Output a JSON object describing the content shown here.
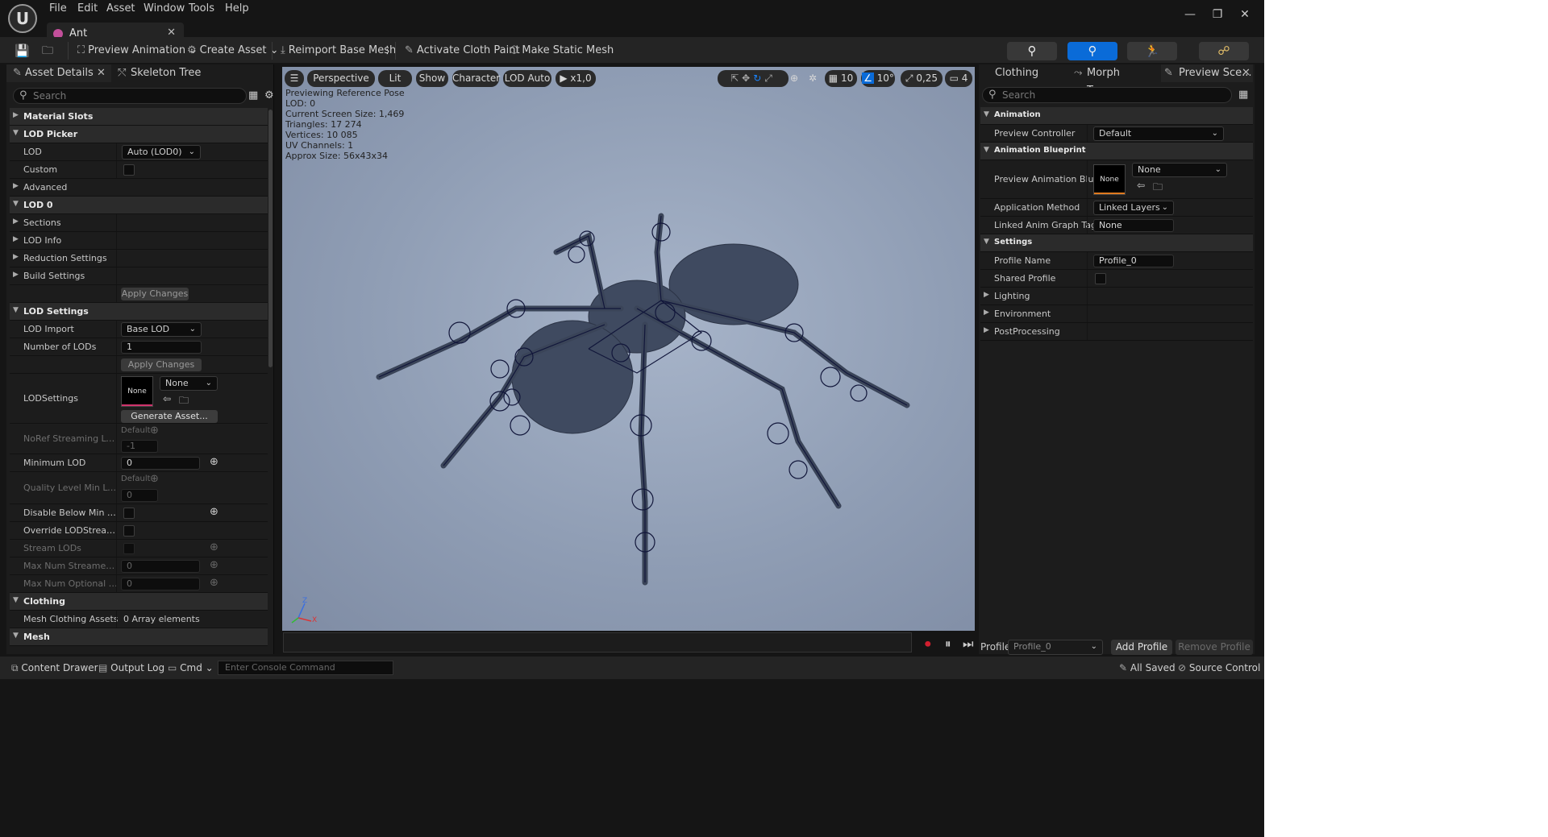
{
  "menu": [
    "File",
    "Edit",
    "Asset",
    "Window",
    "Tools",
    "Help"
  ],
  "document_tab": {
    "title": "Ant"
  },
  "toolbar": {
    "preview_animation": "Preview Animation",
    "create_asset": "Create Asset",
    "reimport": "Reimport Base Mesh",
    "cloth_paint": "Activate Cloth Paint",
    "make_static": "Make Static Mesh"
  },
  "left_panel": {
    "tab1": "Asset Details",
    "tab2": "Skeleton Tree",
    "search_placeholder": "Search",
    "rows": {
      "material_slots": "Material Slots",
      "lod_picker": "LOD Picker",
      "lod": "LOD",
      "lod_value": "Auto (LOD0)",
      "custom": "Custom",
      "advanced": "Advanced",
      "lod0": "LOD 0",
      "sections": "Sections",
      "lod_info": "LOD Info",
      "reduction": "Reduction Settings",
      "build": "Build Settings",
      "apply_changes": "Apply Changes",
      "lod_settings": "LOD Settings",
      "lod_import": "LOD Import",
      "lod_import_value": "Base LOD",
      "num_lods": "Number of LODs",
      "num_lods_value": "1",
      "lodsettings": "LODSettings",
      "none": "None",
      "generate": "Generate Asset...",
      "noref": "NoRef Streaming LOD Bias",
      "default": "Default",
      "noref_value": "-1",
      "min_lod": "Minimum LOD",
      "min_lod_value": "0",
      "quality_min": "Quality Level Min LOD",
      "quality_value": "0",
      "disable_below": "Disable Below Min Lod St...",
      "override_stream": "Override LODStreaming...",
      "stream_lods": "Stream LODs",
      "max_streamed": "Max Num Streamed LODs",
      "max_streamed_value": "0",
      "max_optional": "Max Num Optional LODs",
      "max_optional_value": "0",
      "clothing": "Clothing",
      "mesh_clothing": "Mesh Clothing Assets",
      "array_elements": "0 Array elements",
      "mesh": "Mesh"
    }
  },
  "viewport": {
    "buttons": {
      "perspective": "Perspective",
      "lit": "Lit",
      "show": "Show",
      "character": "Character",
      "lod_auto": "LOD Auto",
      "speed": "x1,0",
      "grid": "10",
      "angle": "10°",
      "scale": "0,25",
      "camera": "4"
    },
    "stats": [
      "Previewing Reference Pose",
      "LOD: 0",
      "Current Screen Size: 1,469",
      "Triangles: 17 274",
      "Vertices: 10 085",
      "UV Channels: 1",
      "Approx Size: 56x43x34"
    ],
    "axis": {
      "x": "X",
      "z": "Z"
    }
  },
  "right_panel": {
    "tab1": "Clothing",
    "tab2": "Morph Targe...",
    "tab3": "Preview Sce...",
    "search_placeholder": "Search",
    "rows": {
      "animation": "Animation",
      "preview_controller": "Preview Controller",
      "preview_controller_value": "Default",
      "anim_bp": "Animation Blueprint",
      "preview_anim_bp": "Preview Animation Bluepri...",
      "none": "None",
      "application_method": "Application Method",
      "application_value": "Linked Layers",
      "linked_tag": "Linked Anim Graph Tag",
      "linked_tag_value": "None",
      "settings": "Settings",
      "profile_name": "Profile Name",
      "profile_name_value": "Profile_0",
      "shared_profile": "Shared Profile",
      "lighting": "Lighting",
      "environment": "Environment",
      "postprocessing": "PostProcessing"
    },
    "profile_label": "Profile",
    "profile_value": "Profile_0",
    "add_profile": "Add Profile",
    "remove_profile": "Remove Profile"
  },
  "bottom_bar": {
    "content_drawer": "Content Drawer",
    "output_log": "Output Log",
    "cmd": "Cmd",
    "console_placeholder": "Enter Console Command",
    "all_saved": "All Saved",
    "source_control": "Source Control"
  },
  "colors": {
    "accent_blue": "#0a6bd8",
    "thumb_pink": "#d0336c",
    "thumb_orange": "#e07a1f",
    "play_record": "#d11f2f"
  }
}
